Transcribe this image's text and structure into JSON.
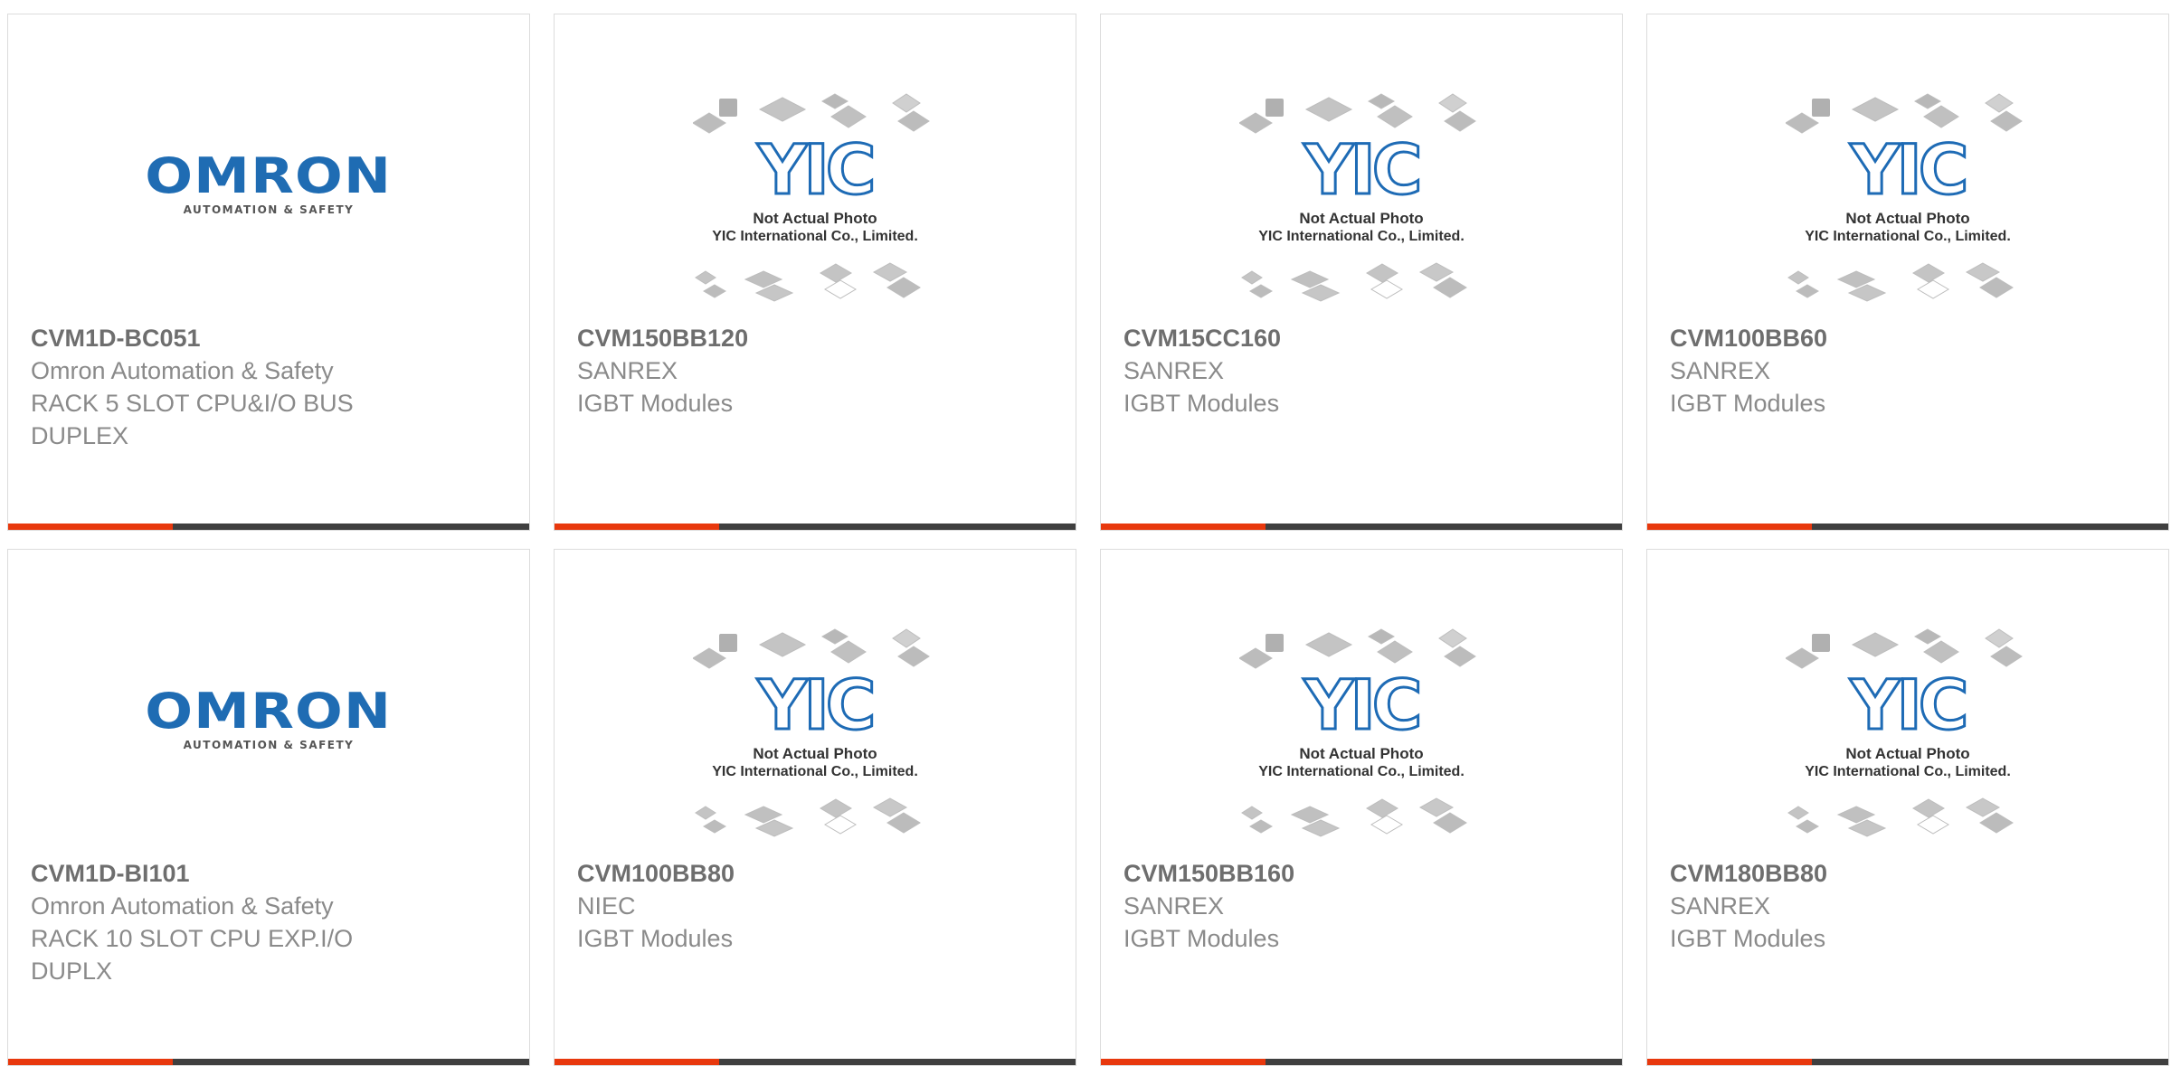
{
  "products": [
    {
      "part": "CVM1D-BC051",
      "manufacturer": "Omron Automation & Safety",
      "description": "RACK 5 SLOT CPU&I/O BUS DUPLEX",
      "image": "omron-logo"
    },
    {
      "part": "CVM150BB120",
      "manufacturer": "SANREX",
      "description": "IGBT Modules",
      "image": "yic-placeholder"
    },
    {
      "part": "CVM15CC160",
      "manufacturer": "SANREX",
      "description": "IGBT Modules",
      "image": "yic-placeholder"
    },
    {
      "part": "CVM100BB60",
      "manufacturer": "SANREX",
      "description": "IGBT Modules",
      "image": "yic-placeholder"
    },
    {
      "part": "CVM1D-BI101",
      "manufacturer": "Omron Automation & Safety",
      "description": "RACK 10 SLOT CPU EXP.I/O DUPLX",
      "image": "omron-logo"
    },
    {
      "part": "CVM100BB80",
      "manufacturer": "NIEC",
      "description": "IGBT Modules",
      "image": "yic-placeholder"
    },
    {
      "part": "CVM150BB160",
      "manufacturer": "SANREX",
      "description": "IGBT Modules",
      "image": "yic-placeholder"
    },
    {
      "part": "CVM180BB80",
      "manufacturer": "SANREX",
      "description": "IGBT Modules",
      "image": "yic-placeholder"
    }
  ],
  "omron_logo": {
    "word": "OMRON",
    "tagline": "AUTOMATION & SAFETY"
  },
  "placeholder": {
    "line1": "Not Actual Photo",
    "line2": "YIC International Co., Limited.",
    "mark": "YIC"
  },
  "colors": {
    "accent": "#e8380d",
    "bar": "#3f3f3f",
    "brand_blue": "#1f6cb3"
  }
}
